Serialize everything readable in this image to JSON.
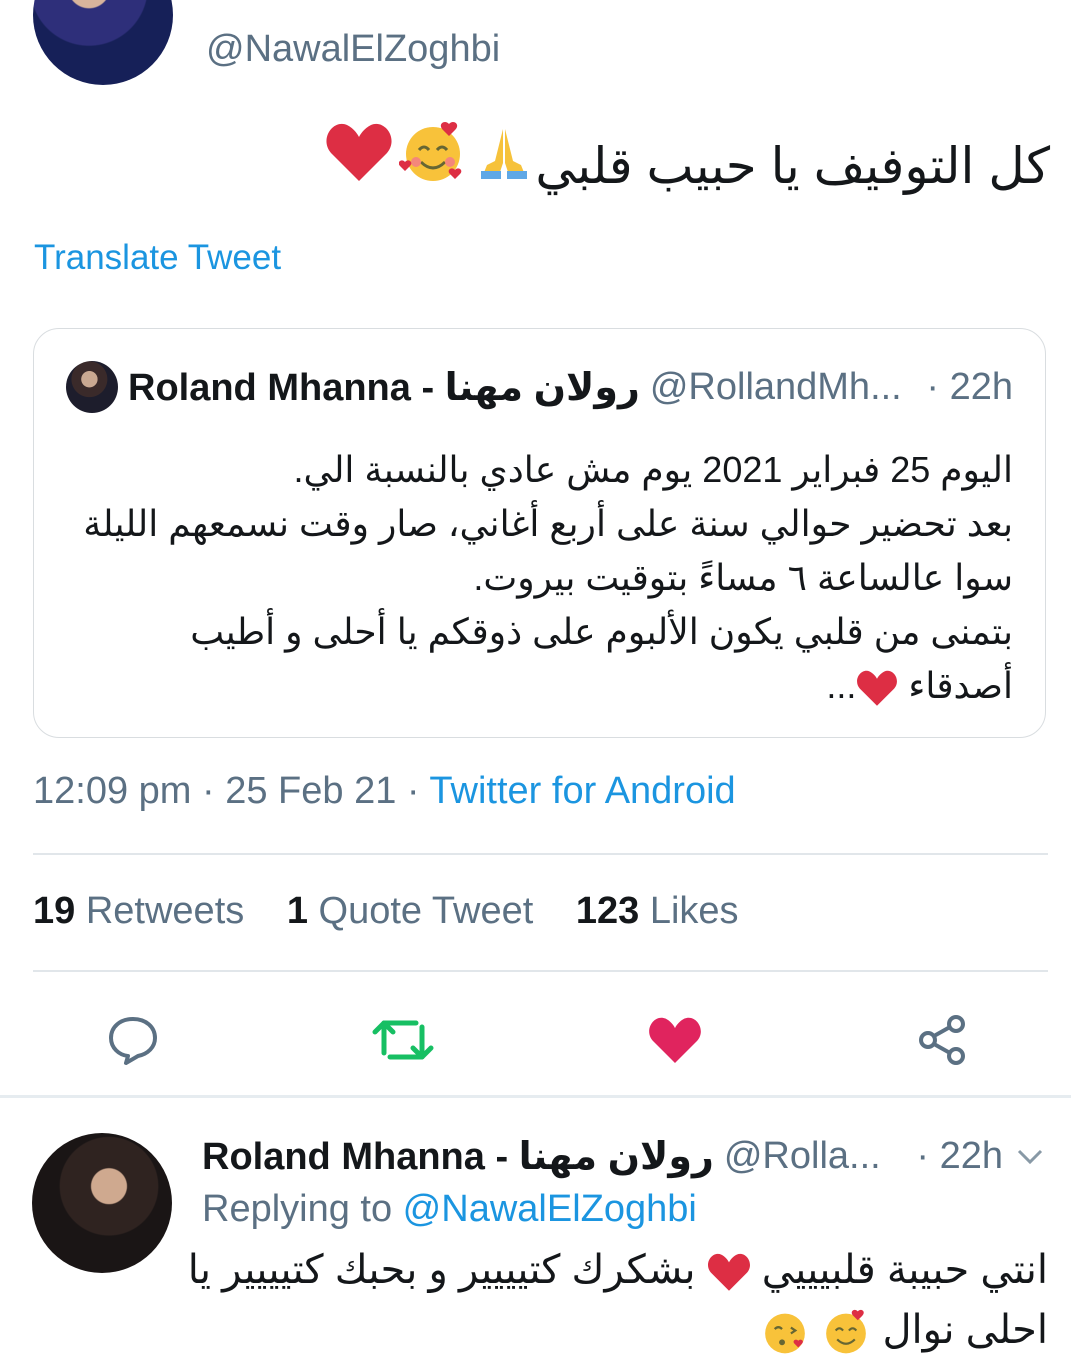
{
  "original_tweet": {
    "handle": "@NawalElZoghbi",
    "text": "كل التوفيف يا حبيب قلبي",
    "emojis": [
      "folded-hands-icon",
      "smiling-face-with-hearts-icon",
      "red-heart-icon"
    ],
    "translate_label": "Translate Tweet",
    "timestamp": "12:09 pm · 25 Feb 21 · ",
    "source": "Twitter for Android"
  },
  "quoted_tweet": {
    "name": "Roland Mhanna - رولان مهنا",
    "handle": "@RollandMh...",
    "time": "· 22h",
    "lines": [
      "اليوم 25 فبراير 2021 يوم مش عادي بالنسبة الي.",
      "بعد تحضير حوالي سنة على أربع أغاني، صار وقت نسمعهم الليلة",
      "سوا عالساعة ٦ مساءً بتوقيت بيروت.",
      "بتمنى من قلبي يكون الألبوم على ذوقكم يا أحلى و أطيب",
      "أصدقاء"
    ],
    "ellipsis": "..."
  },
  "stats": {
    "retweets_count": "19",
    "retweets_label": "Retweets",
    "quotes_count": "1",
    "quotes_label": "Quote Tweet",
    "likes_count": "123",
    "likes_label": "Likes"
  },
  "actions": [
    "reply-icon",
    "retweet-icon",
    "like-icon",
    "share-icon"
  ],
  "colors": {
    "link": "#1b95e0",
    "secondary_text": "#5b7083",
    "retweet": "#17bf63",
    "like": "#e0245e",
    "heart_emoji": "#dd2e44"
  },
  "reply": {
    "name": "Roland Mhanna - رولان مهنا",
    "handle": "@Rolla...",
    "time": "· 22h",
    "replying_prefix": "Replying to ",
    "replying_to": "@NawalElZoghbi",
    "line1_part1": "انتي حبيبة قلبيييي",
    "line1_part2": "بشكرك كتيييير و بحبك كتيييير يا",
    "line2": "احلى نوال"
  }
}
